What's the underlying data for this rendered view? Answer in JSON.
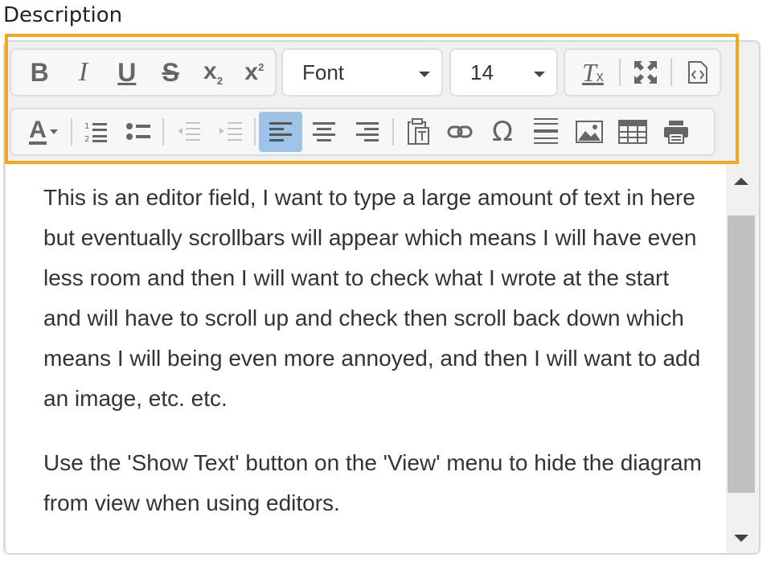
{
  "label": "Description",
  "toolbar": {
    "font_value": "Font",
    "size_value": "14",
    "icons": {
      "bold": "B",
      "italic": "I",
      "underline": "U",
      "strike": "S",
      "subscript": "x",
      "subscript_mark": "2",
      "superscript": "x",
      "superscript_mark": "2",
      "clear_format": "T",
      "clear_format_mark": "x",
      "font_color": "A",
      "special_char": "Ω"
    }
  },
  "content": {
    "paragraph1": "This is an editor field, I want to type a large amount of text in here but eventually scrollbars will appear which means I will have even less room and then I will want to check what I wrote at the start and will have to scroll up and check then scroll back down which means I will being even more annoyed, and then I will want to add an image, etc. etc.",
    "paragraph2": "Use the 'Show Text' button on the 'View' menu to hide the diagram from view when using editors."
  },
  "colors": {
    "highlight_border": "#f0a81c",
    "active_button": "#9dc3e8"
  }
}
